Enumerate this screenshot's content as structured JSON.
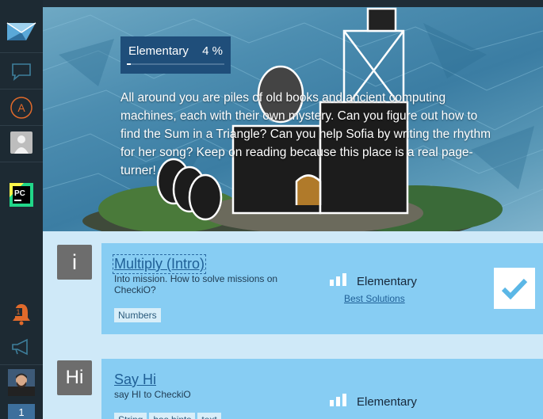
{
  "hero": {
    "level_label": "Elementary",
    "progress_text": "4 %",
    "progress_fraction": 0.04,
    "description": "All around you are piles of old books and ancient computing machines, each with their own mystery. Can you figure out how to find the Sum in a Triangle? Can you help Sofia by writing the rhythm for her song? Keep on reading because this place is a real page-turner!"
  },
  "sidebar": {
    "items": [
      {
        "icon": "checkio-logo-icon"
      },
      {
        "icon": "chat-bubble-icon"
      },
      {
        "icon": "a-circle-icon",
        "text": "A"
      },
      {
        "icon": "user-silhouette-icon"
      },
      {
        "icon": "pycharm-icon",
        "text": "PC"
      },
      {
        "icon": "notification-bell-icon",
        "count": "1"
      },
      {
        "icon": "megaphone-icon"
      },
      {
        "icon": "user-avatar-icon"
      },
      {
        "icon": "level-badge-icon",
        "text": "1"
      }
    ]
  },
  "missions": [
    {
      "badge": "i",
      "title": "Multiply (Intro)",
      "description": "Into mission. How to solve missions on CheckiO?",
      "tags": [
        "Numbers"
      ],
      "difficulty": "Elementary",
      "best_solutions": "Best Solutions",
      "solved": true
    },
    {
      "badge": "Hi",
      "title": "Say Hi",
      "description": "say HI to CheckiO",
      "tags": [
        "String",
        "has hints",
        "text"
      ],
      "difficulty": "Elementary"
    }
  ],
  "colors": {
    "sidebar_bg": "#1d2a33",
    "accent_orange": "#e06a2b",
    "card_bg": "#87cdf3",
    "strip_bg": "#cfe9f8",
    "hero_box": "#1f4e7a"
  }
}
